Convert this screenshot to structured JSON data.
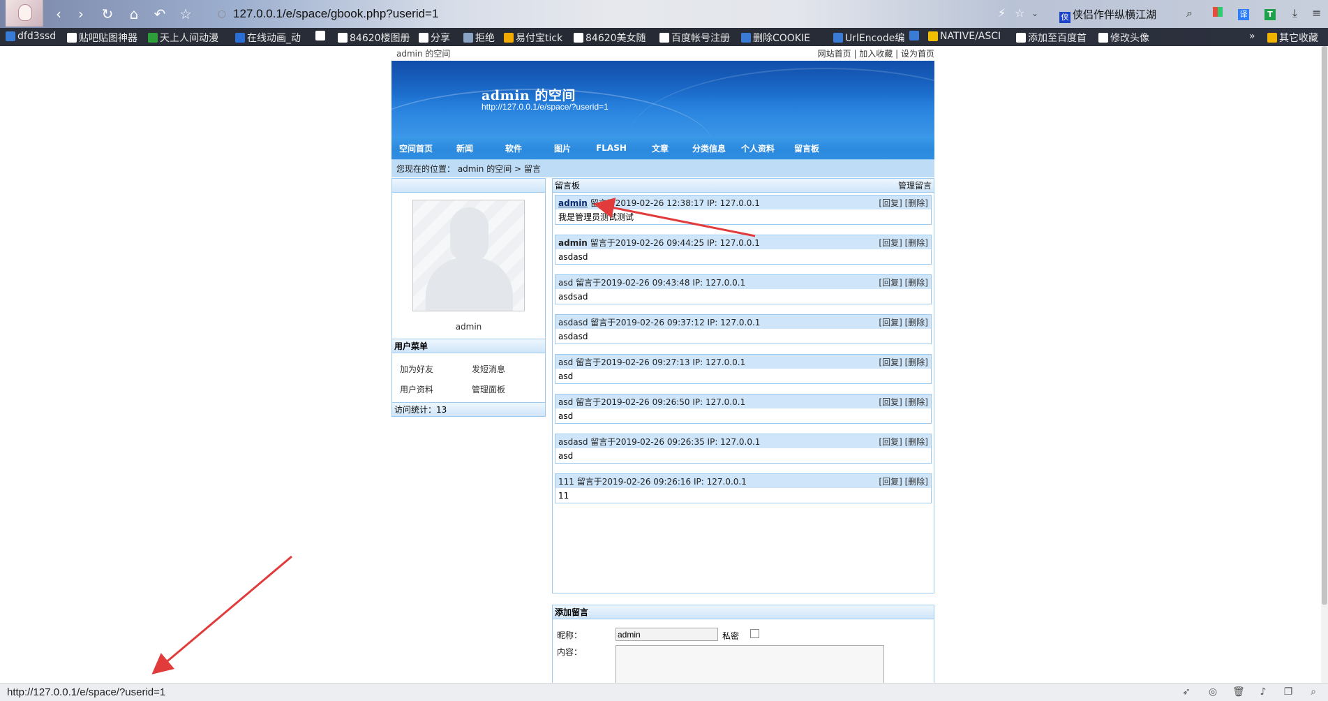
{
  "browser": {
    "url": "127.0.0.1/e/space/gbook.php?userid=1",
    "tab_title": "侠侣作伴纵横江湖",
    "tab_icon_letter": "侠",
    "bookmarks": [
      {
        "label": "dfd3ssd",
        "color": "#3a7bd5"
      },
      {
        "label": "贴吧贴图神器",
        "color": "#ffffff"
      },
      {
        "label": "天上人间动漫",
        "color": "#2e9e3a"
      },
      {
        "label": "在线动画_动",
        "color": "#2a6fd6"
      },
      {
        "label": "",
        "color": "#ffffff"
      },
      {
        "label": "84620楼图册",
        "color": "#ffffff"
      },
      {
        "label": "分享",
        "color": "#ffffff"
      },
      {
        "label": "拒绝",
        "color": "#8aa3c2"
      },
      {
        "label": "易付宝tick",
        "color": "#f2a900"
      },
      {
        "label": "84620美女随",
        "color": "#ffffff"
      },
      {
        "label": "百度帐号注册",
        "color": "#ffffff"
      },
      {
        "label": "删除COOKIE",
        "color": "#3a7bd5"
      },
      {
        "label": "UrlEncode编",
        "color": "#3a7bd5"
      },
      {
        "label": "",
        "color": "#3a7bd5"
      },
      {
        "label": "NATIVE/ASCI",
        "color": "#f0c000"
      },
      {
        "label": "添加至百度首",
        "color": "#ffffff"
      },
      {
        "label": "修改头像",
        "color": "#ffffff"
      },
      {
        "label": "其它收藏",
        "color": "#f0b400"
      }
    ],
    "status_url": "http://127.0.0.1/e/space/?userid=1"
  },
  "topbar": {
    "left": "admin 的空间",
    "links": [
      "网站首页",
      "加入收藏",
      "设为首页"
    ]
  },
  "banner": {
    "title": "admin 的空间",
    "url": "http://127.0.0.1/e/space/?userid=1"
  },
  "nav": [
    "空间首页",
    "新闻",
    "软件",
    "图片",
    "FLASH",
    "文章",
    "分类信息",
    "个人资料",
    "留言板"
  ],
  "crumb": "您现在的位置： admin 的空间 > 留言",
  "sidebar": {
    "username": "admin",
    "menu_title": "用户菜单",
    "menu": [
      "加为好友",
      "发短消息",
      "用户资料",
      "管理面板"
    ],
    "visits": "访问统计：13"
  },
  "guestbook": {
    "title": "留言板",
    "manage": "管理留言",
    "reply_label": "[回复]",
    "delete_label": "[删除]",
    "messages": [
      {
        "author": "admin",
        "meta": "留言于2019-02-26 12:38:17 IP: 127.0.0.1",
        "body": "我是管理员测试测试"
      },
      {
        "author": "admin",
        "meta": "留言于2019-02-26 09:44:25 IP: 127.0.0.1",
        "body": "asdasd"
      },
      {
        "author": "asd",
        "meta": "留言于2019-02-26 09:43:48 IP: 127.0.0.1",
        "body": "asdsad"
      },
      {
        "author": "asdasd",
        "meta": "留言于2019-02-26 09:37:12 IP: 127.0.0.1",
        "body": "asdasd"
      },
      {
        "author": "asd",
        "meta": "留言于2019-02-26 09:27:13 IP: 127.0.0.1",
        "body": "asd"
      },
      {
        "author": "asd",
        "meta": "留言于2019-02-26 09:26:50 IP: 127.0.0.1",
        "body": "asd"
      },
      {
        "author": "asdasd",
        "meta": "留言于2019-02-26 09:26:35 IP: 127.0.0.1",
        "body": "asd"
      },
      {
        "author": "111",
        "meta": "留言于2019-02-26 09:26:16 IP: 127.0.0.1",
        "body": "11"
      }
    ]
  },
  "add_form": {
    "title": "添加留言",
    "nick_label": "昵称：",
    "nick_value": "admin",
    "private_label": "私密",
    "content_label": "内容："
  },
  "colors": {
    "banner_blue": "#1f74d4",
    "nav_blue": "#2c8ade",
    "box_border": "#9ccaf1",
    "annotation_red": "#e23b3b"
  }
}
